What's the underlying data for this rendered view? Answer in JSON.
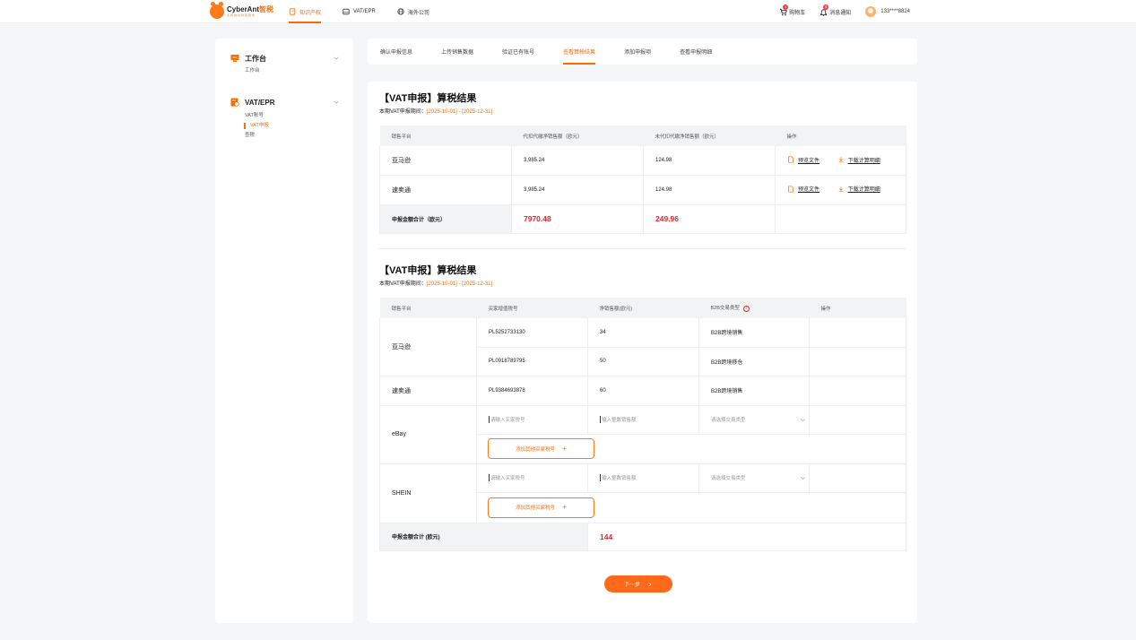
{
  "header": {
    "logo_name": "CyberAnt",
    "logo_cn": "智税",
    "logo_sub": "全球跨境财税服务",
    "nav": [
      {
        "label": "知识产权",
        "active": true
      },
      {
        "label": "VAT/EPR",
        "active": false
      },
      {
        "label": "海外公司",
        "active": false
      }
    ],
    "cart_label": "购物车",
    "cart_badge": "1",
    "notify_label": "消息通知",
    "notify_badge": "8",
    "user": "133****8824"
  },
  "sidebar": {
    "groups": [
      {
        "title": "工作台",
        "items": [
          {
            "label": "工作台",
            "active": false
          }
        ]
      },
      {
        "title": "VAT/EPR",
        "items": [
          {
            "label": "VAT账号",
            "active": false
          },
          {
            "label": "VAT申报",
            "active": true
          },
          {
            "label": "查税",
            "active": false
          }
        ]
      }
    ]
  },
  "tabs": [
    {
      "label": "确认申报信息",
      "active": false
    },
    {
      "label": "上传销售数据",
      "active": false
    },
    {
      "label": "验证已有账号",
      "active": false
    },
    {
      "label": "查看算税结果",
      "active": true
    },
    {
      "label": "添加申报项",
      "active": false
    },
    {
      "label": "查看申报明细",
      "active": false
    }
  ],
  "section1": {
    "title": "【VAT申报】算税结果",
    "period_label": "本期VAT申报期间：",
    "period_value": "[2025-10-01] - [2025-12-31]",
    "headers": [
      "销售平台",
      "代扣代缴净销售额（欧元）",
      "未代扣代缴净销售额（欧元）",
      "操作"
    ],
    "rows": [
      {
        "platform": "亚马逊",
        "withheld": "3,985.24",
        "not_withheld": "124.98",
        "preview": "预览文件",
        "download": "下载计算明细"
      },
      {
        "platform": "速卖通",
        "withheld": "3,985.24",
        "not_withheld": "124.98",
        "preview": "预览文件",
        "download": "下载计算明细"
      }
    ],
    "total_label": "申报金额合计（欧元）",
    "total_withheld": "7970.48",
    "total_not_withheld": "249.96"
  },
  "section2": {
    "title": "【VAT申报】算税结果",
    "period_label": "本期VAT申报期间：",
    "period_value": "[2025-10-01] - [2025-12-31]",
    "headers": [
      "销售平台",
      "买家增值税号",
      "净销售额(欧元)",
      "B2B交易类型",
      "操作"
    ],
    "amazon": {
      "platform": "亚马逊",
      "rows": [
        {
          "vat": "PL5252733130",
          "amount": "34",
          "type": "B2B跨境销售"
        },
        {
          "vat": "PL0918789795",
          "amount": "50",
          "type": "B2B跨境移仓"
        }
      ]
    },
    "aliexpress": {
      "platform": "速卖通",
      "vat": "PL9384693878",
      "amount": "60",
      "type": "B2B跨境销售"
    },
    "ebay": {
      "platform": "eBay"
    },
    "shein": {
      "platform": "SHEIN"
    },
    "vat_placeholder": "请输入买家税号",
    "amount_placeholder": "输入整数销售额",
    "type_placeholder": "请选择交易类型",
    "add_label": "添加其他买家税号",
    "total_label": "申报金额合计 (欧元)",
    "total_value": "144"
  },
  "next_label": "下一步",
  "colors": {
    "accent": "#ff6a00",
    "total_red": "#e8252b"
  }
}
